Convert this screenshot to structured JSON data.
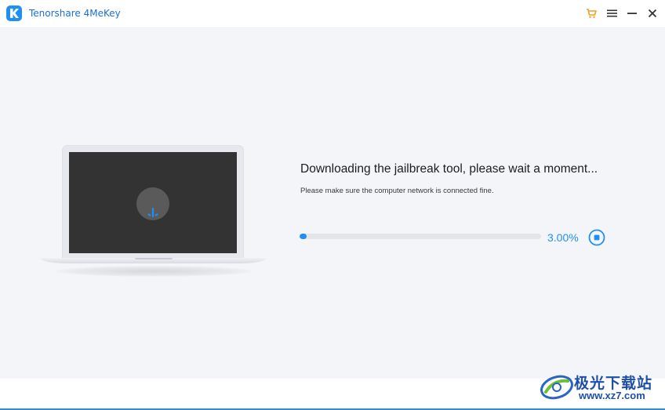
{
  "window": {
    "title": "Tenorshare 4MeKey",
    "icons": [
      "cart-icon",
      "menu-icon",
      "minimize-icon",
      "close-icon"
    ]
  },
  "main": {
    "heading": "Downloading the jailbreak tool, please wait a moment...",
    "subtext": "Please make sure the computer network is connected fine.",
    "progress": {
      "percent_text": "3.00%",
      "value": 0.03
    }
  },
  "watermark": {
    "text": "极光下载站",
    "url": "www.xz7.com"
  },
  "colors": {
    "accent": "#1e90f5",
    "title_text": "#1a6fd6",
    "background": "#f4f5f9",
    "screen": "#333333"
  }
}
